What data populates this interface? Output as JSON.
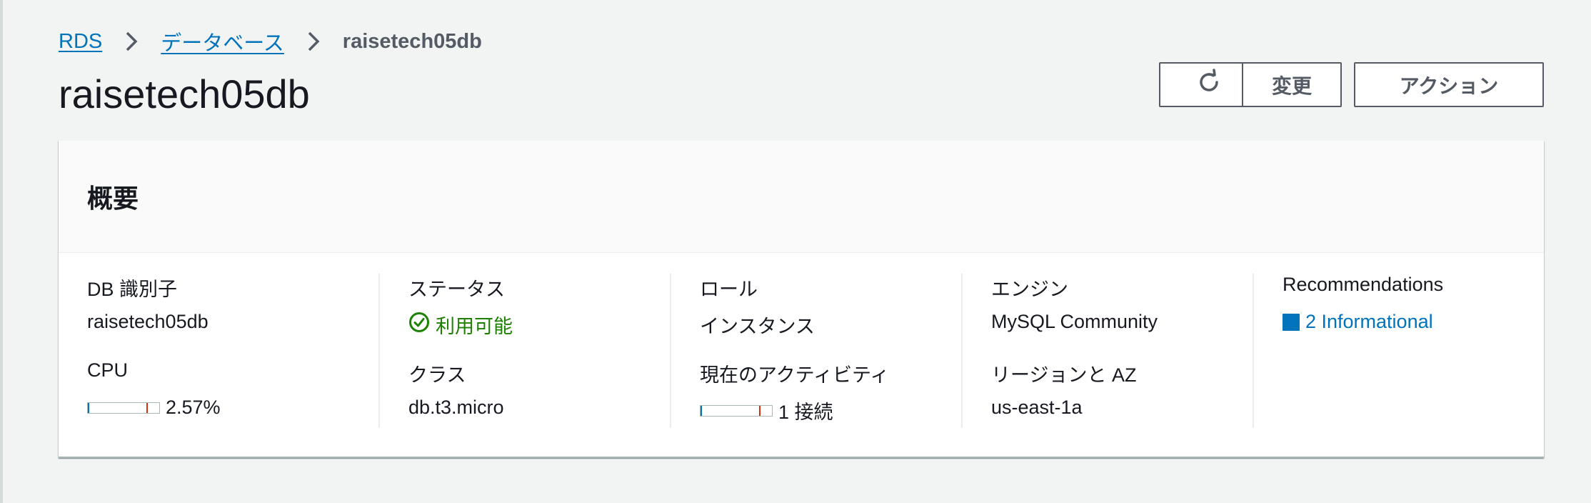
{
  "breadcrumb": {
    "items": [
      {
        "label": "RDS"
      },
      {
        "label": "データベース"
      }
    ],
    "current": "raisetech05db"
  },
  "page": {
    "title": "raisetech05db"
  },
  "toolbar": {
    "refresh_icon": "refresh-icon",
    "modify_label": "変更",
    "actions_label": "アクション"
  },
  "summary": {
    "title": "概要",
    "db_identifier": {
      "label": "DB 識別子",
      "value": "raisetech05db"
    },
    "cpu": {
      "label": "CPU",
      "value": "2.57%",
      "fraction": 0.0257
    },
    "status": {
      "label": "ステータス",
      "value": "利用可能",
      "color": "#1d8102"
    },
    "class": {
      "label": "クラス",
      "value": "db.t3.micro"
    },
    "role": {
      "label": "ロール",
      "value": "インスタンス"
    },
    "activity": {
      "label": "現在のアクティビティ",
      "value": "1 接続"
    },
    "engine": {
      "label": "エンジン",
      "value": "MySQL Community"
    },
    "region_az": {
      "label": "リージョンと AZ",
      "value": "us-east-1a"
    },
    "recommendations": {
      "label": "Recommendations",
      "value": "2 Informational",
      "color": "#0073bb"
    }
  },
  "colors": {
    "link": "#0073bb",
    "success": "#1d8102",
    "meter_warning": "#d13212"
  }
}
